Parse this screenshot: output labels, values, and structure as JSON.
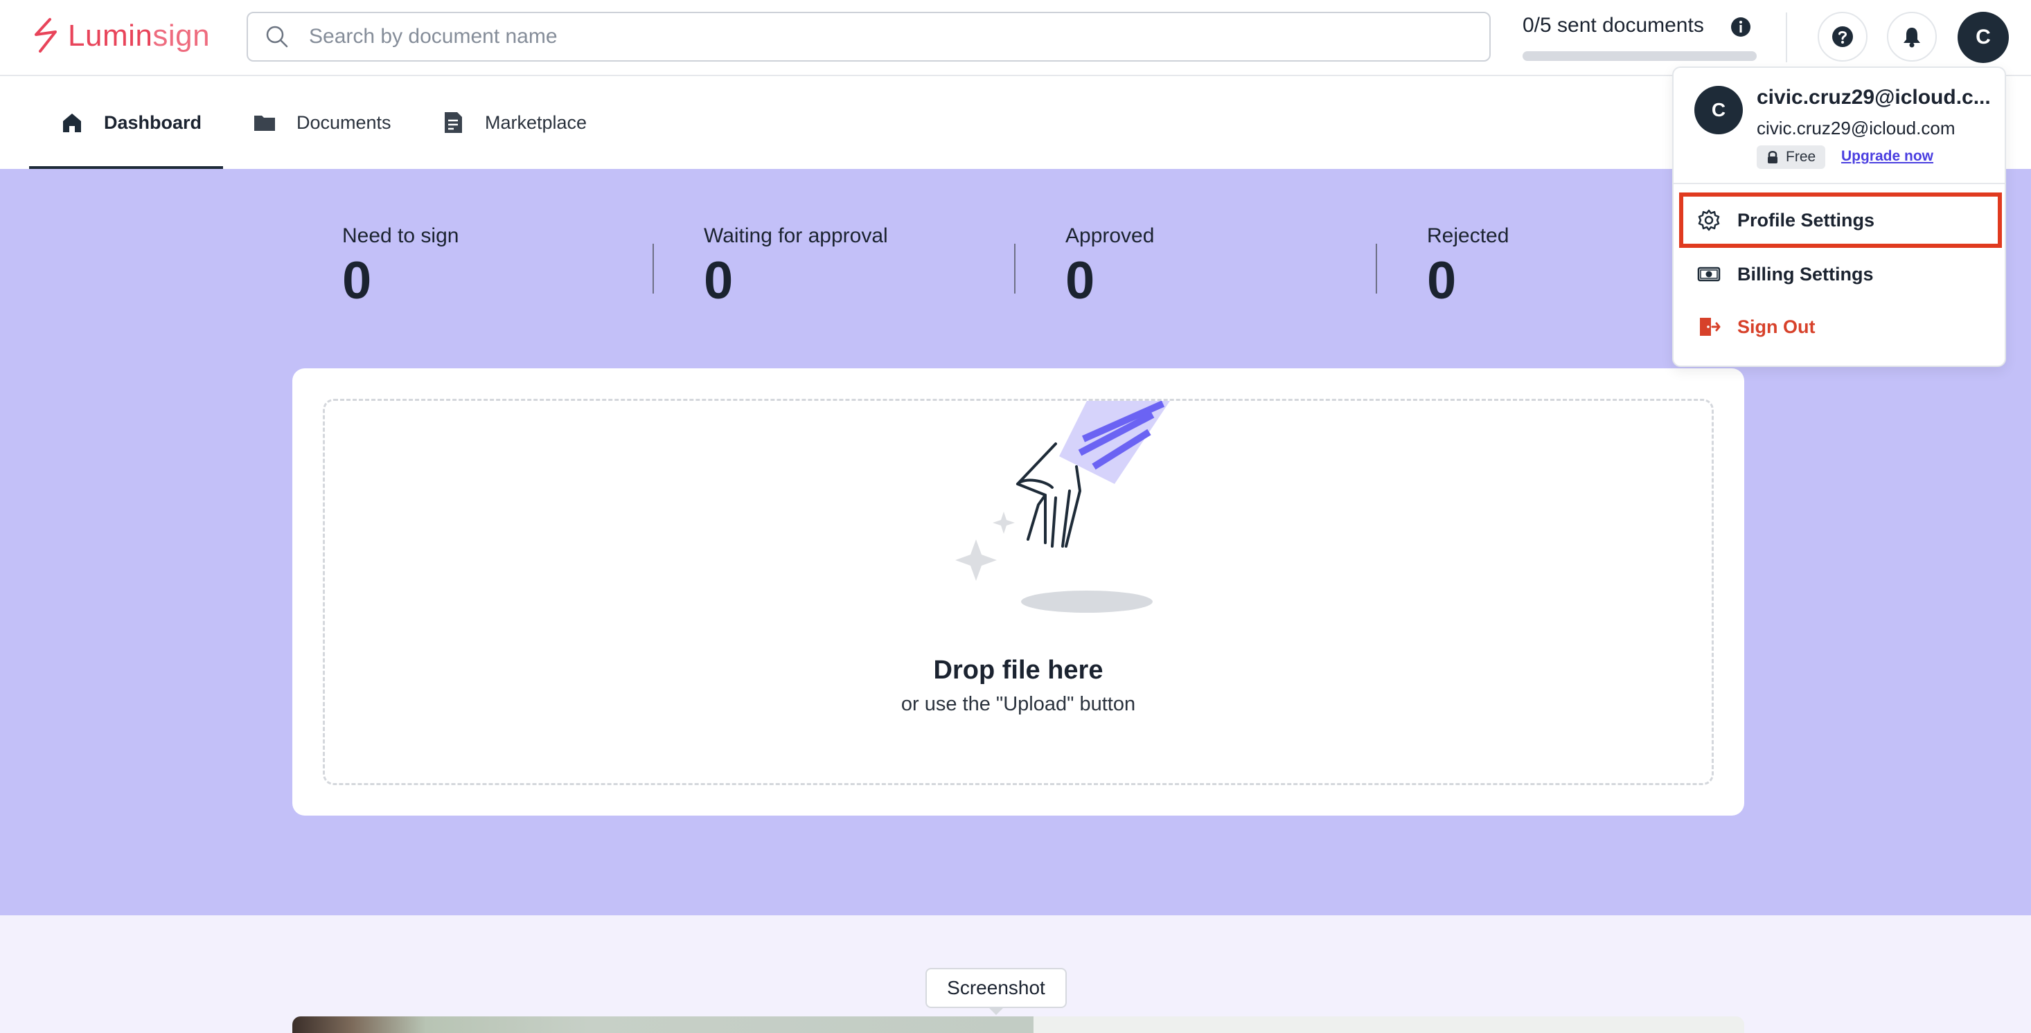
{
  "header": {
    "logo_text_main": "Lumin",
    "logo_text_accent": "sign",
    "search_placeholder": "Search by document name",
    "sent_documents_label": "0/5 sent documents",
    "sent_documents_progress": 0.0,
    "help_icon": "help-circle-icon",
    "notifications_icon": "bell-icon",
    "avatar_initial": "C"
  },
  "nav": {
    "tabs": [
      {
        "label": "Dashboard",
        "icon": "home-icon",
        "active": true
      },
      {
        "label": "Documents",
        "icon": "folder-icon",
        "active": false
      },
      {
        "label": "Marketplace",
        "icon": "document-icon",
        "active": false
      }
    ]
  },
  "stats": [
    {
      "label": "Need to sign",
      "value": "0"
    },
    {
      "label": "Waiting for approval",
      "value": "0"
    },
    {
      "label": "Approved",
      "value": "0"
    },
    {
      "label": "Rejected",
      "value": "0"
    }
  ],
  "dropzone": {
    "title": "Drop file here",
    "subtitle": "or use the \"Upload\" button"
  },
  "tooltip": {
    "label": "Screenshot"
  },
  "account_menu": {
    "avatar_initial": "C",
    "name": "civic.cruz29@icloud.c...",
    "email": "civic.cruz29@icloud.com",
    "plan": "Free",
    "upgrade_label": "Upgrade now",
    "items": [
      {
        "label": "Profile Settings",
        "icon": "gear-icon"
      },
      {
        "label": "Billing Settings",
        "icon": "banknote-icon"
      },
      {
        "label": "Sign Out",
        "icon": "sign-out-icon"
      }
    ]
  },
  "colors": {
    "brand": "#e8445a",
    "hero_background": "#c3c0f8",
    "accent": "#6b63f3",
    "highlight_border": "#e03a1f",
    "danger": "#d7412a"
  }
}
